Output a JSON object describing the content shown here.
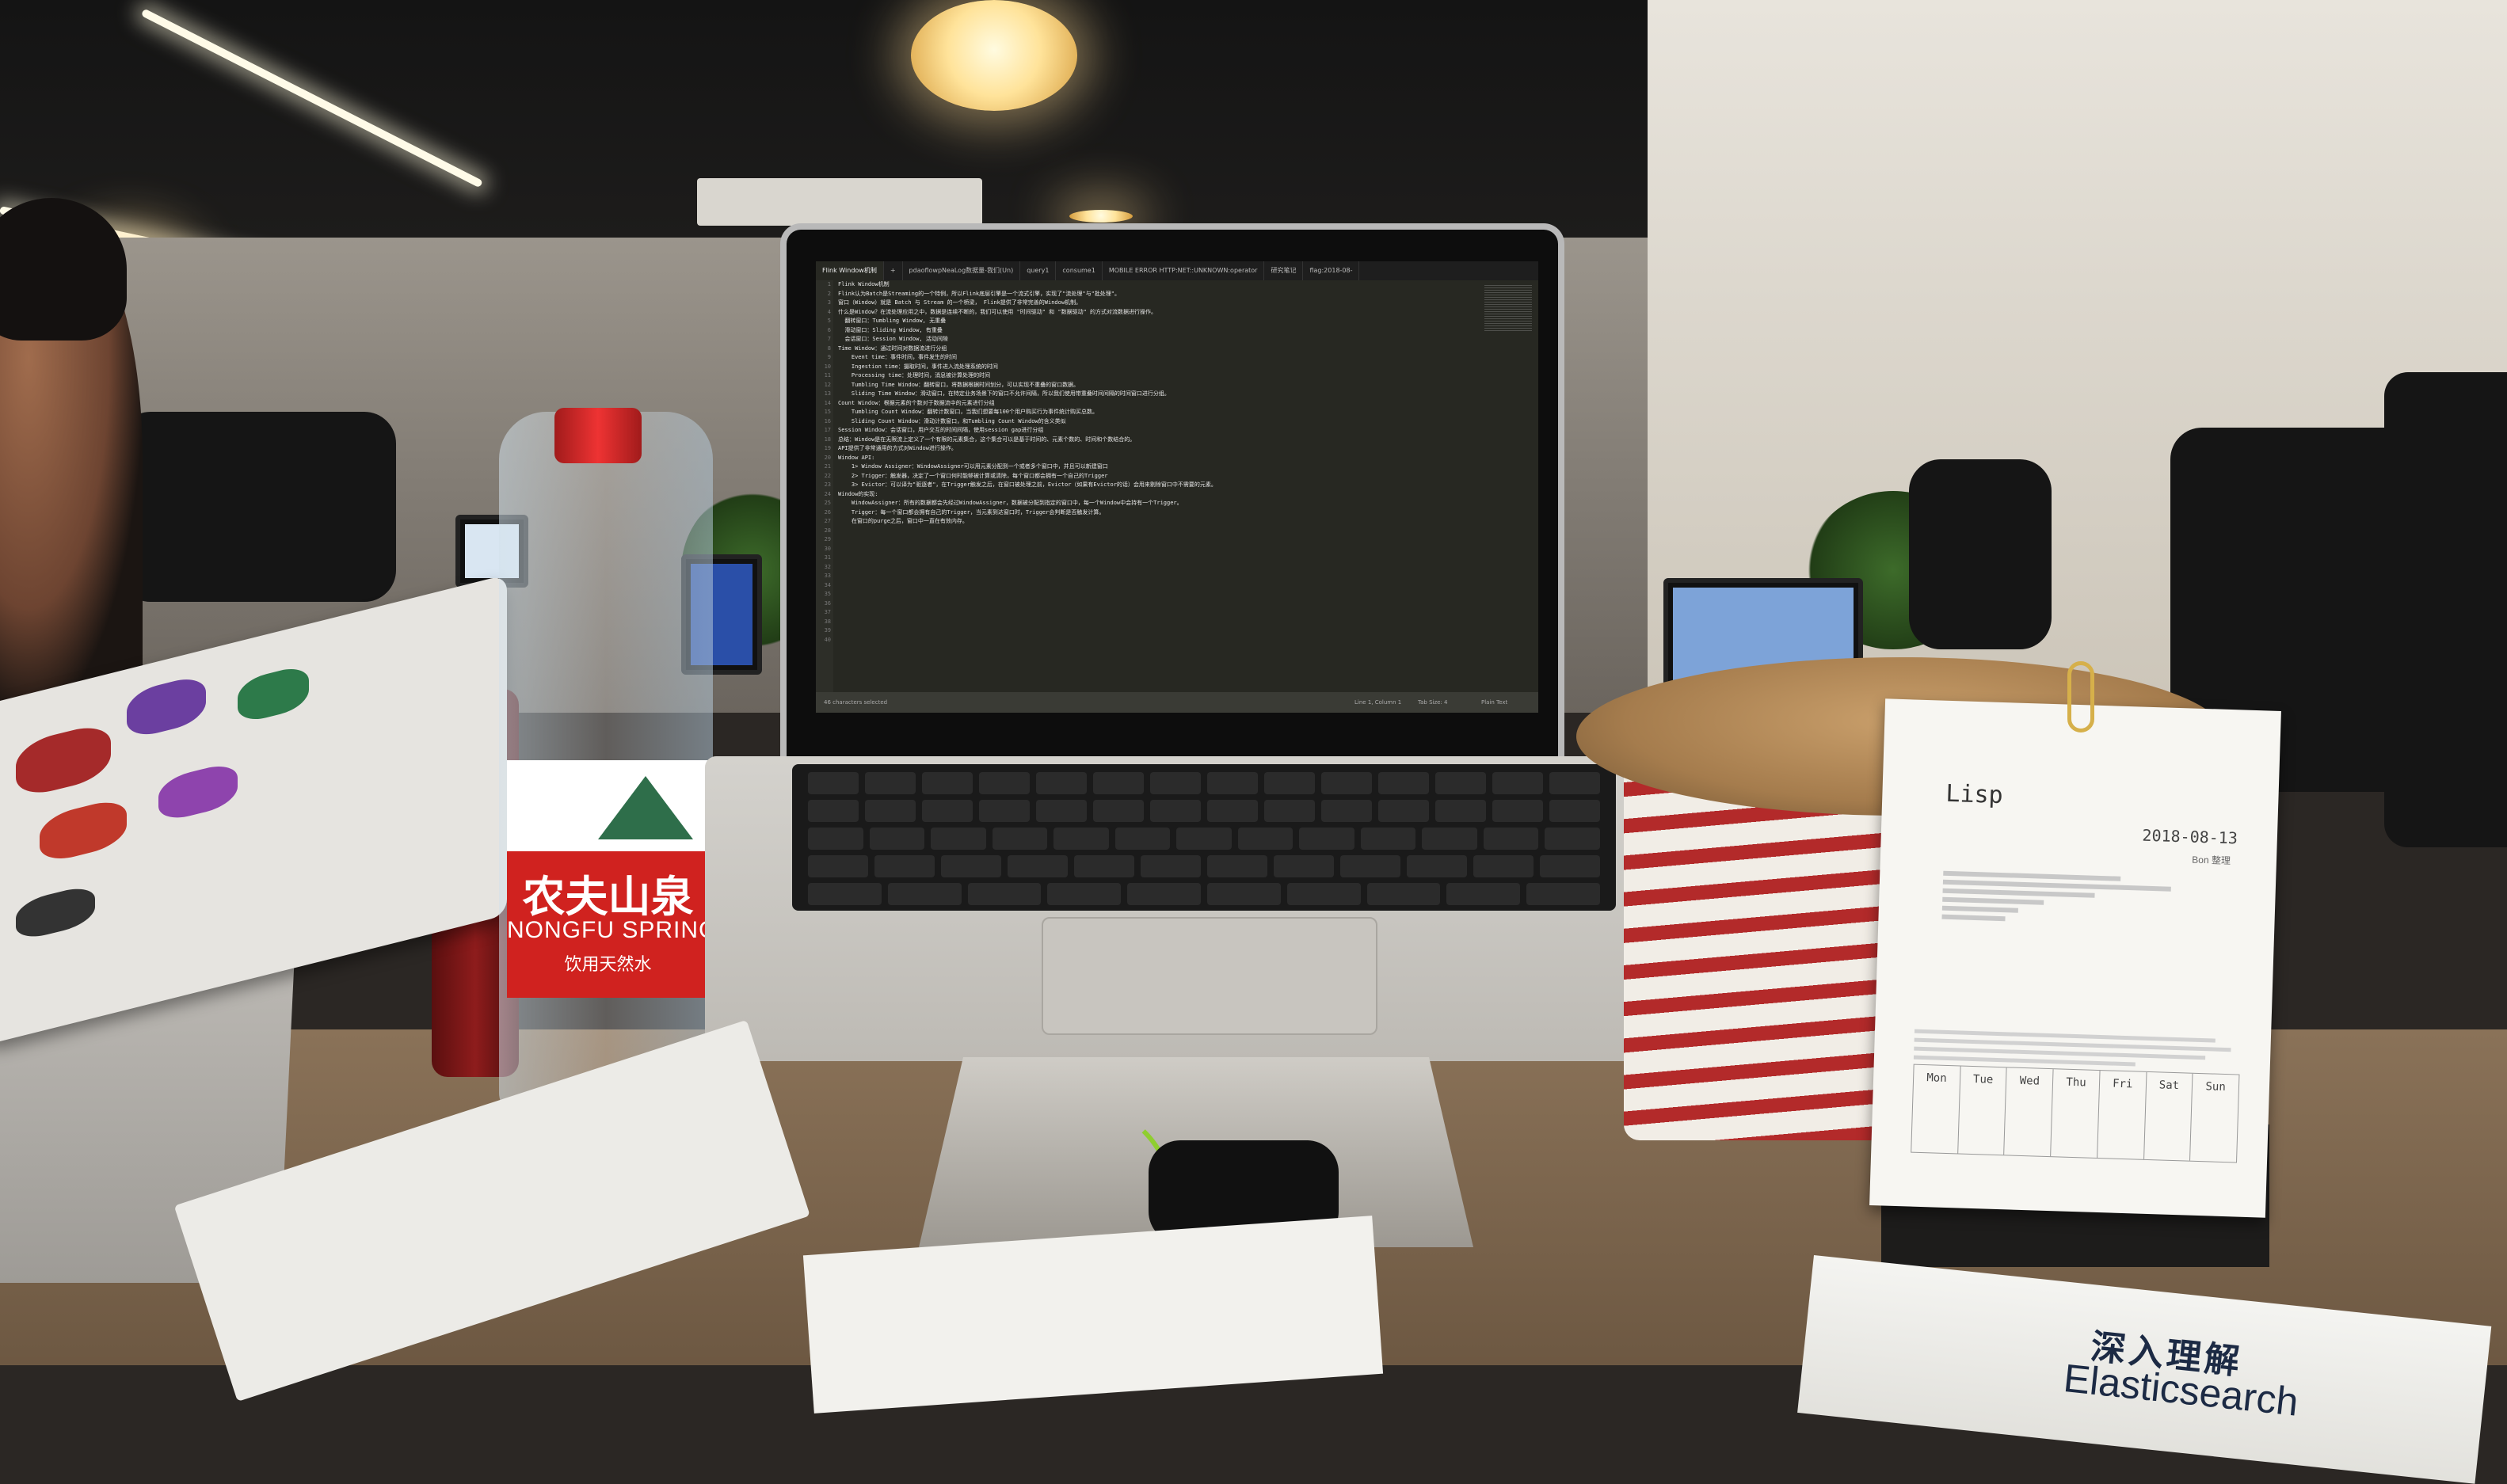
{
  "editor": {
    "tabs": [
      "Flink Window机制",
      "+",
      "pdaoflowpNeaLog数据量-我们(Un)",
      "query1",
      "consume1",
      "MOBILE ERROR HTTP:NET::UNKNOWN:operator",
      "研究笔记",
      "flag:2018-08-"
    ],
    "line_numbers": [
      "1",
      "2",
      "3",
      "4",
      "5",
      "6",
      "7",
      "8",
      "9",
      "10",
      "11",
      "12",
      "13",
      "14",
      "15",
      "16",
      "17",
      "18",
      "19",
      "20",
      "21",
      "22",
      "23",
      "24",
      "25",
      "26",
      "27",
      "28",
      "29",
      "30",
      "31",
      "32",
      "33",
      "34",
      "35",
      "36",
      "37",
      "38",
      "39",
      "40"
    ],
    "lines": [
      "Flink Window机制",
      "",
      "Flink认为Batch是Streaming的一个特例，所以Flink底层引擎是一个流式引擎，实现了\"流处理\"与\"批处理\"。",
      "",
      "窗口（Window）就是 Batch 与 Stream 的一个桥梁， Flink提供了非常完善的Window机制。",
      "",
      "什么是Window？在流处理应用之中，数据是连续不断的，我们可以使用 \"时间驱动\" 和 \"数据驱动\" 的方式对流数据进行操作。",
      "",
      "  翻转窗口：Tumbling Window, 无重叠",
      "  滑动窗口：Sliding Window, 有重叠",
      "  会话窗口：Session Window, 活动间隙",
      "",
      "Time Window：通过时间对数据流进行分组",
      "    Event time：事件时间，事件发生的时间",
      "    Ingestion time：摄取时间，事件进入流处理系统的时间",
      "    Processing time：处理时间，消息被计算处理的时间",
      "",
      "    Tumbling Time Window：翻转窗口，将数据根据时间划分，可以实现不重叠的窗口数据。",
      "    Sliding Time Window：滑动窗口，在特定业务场景下的窗口不允许间隔，所以我们使用带重叠时间间隔的时间窗口进行分组。",
      "",
      "Count Window：根据元素的个数对于数据流中的元素进行分组",
      "    Tumbling Count Window：翻转计数窗口，当我们想要每100个用户购买行为事件统计购买总数。",
      "    Sliding Count Window：滑动计数窗口，和Tumbling Count Window的含义类似",
      "",
      "Session Window：会话窗口，用户交互的时间间隔，使用session gap进行分组",
      "",
      "总结：Window是在无限流上定义了一个有限的元素集合，这个集合可以是基于时间的、元素个数的、时间和个数结合的。",
      "API提供了非常通用的方式对Window进行操作。",
      "",
      "Window API:",
      "    1> Window Assigner：WindowAssigner可以用元素分配到一个或者多个窗口中，并且可以新建窗口",
      "    2> Trigger：触发器，决定了一个窗口何时能够被计算或清除，每个窗口都会拥有一个自己的Trigger",
      "    3> Evictor：可以译为\"驱逐者\"，在Trigger触发之后，在窗口被处理之前，Evictor（如果有Evictor的话）会用来剔除窗口中不需要的元素。",
      "",
      "Window的实现:",
      "    WindowAssigner：所有的数据都会先经过WindowAssigner，数据被分配到指定的窗口中，每一个Window中会持有一个Trigger。",
      "",
      "    Trigger：每一个窗口都会拥有自己的Trigger，当元素到达窗口时，Trigger会判断是否触发计算。",
      "    在窗口的purge之后，窗口中一直在有效内存。",
      ""
    ],
    "status_left": "46 characters selected",
    "status_items": [
      "Line 1, Column 1",
      "Tab Size: 4",
      "Plain Text"
    ]
  },
  "bottle": {
    "brand_cn": "农夫山泉",
    "brand_en": "NONGFU SPRING",
    "tagline": "饮用天然水"
  },
  "calendar": {
    "title": "Lisp",
    "date": "2018-08-13",
    "author": "Bon 整理",
    "days": [
      "Mon",
      "Tue",
      "Wed",
      "Thu",
      "Fri",
      "Sat",
      "Sun"
    ]
  },
  "book": {
    "title_cn": "深入理解",
    "title_en": "Elasticsearch"
  },
  "colors": {
    "editor_bg": "#272822",
    "bottle_red": "#d0221f",
    "calendar_ring": "#d6b04a"
  }
}
